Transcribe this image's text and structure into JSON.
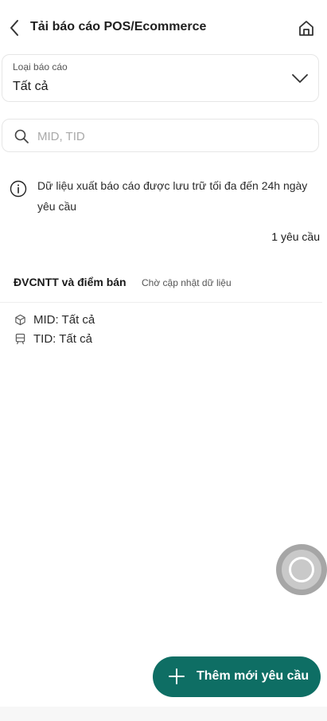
{
  "header": {
    "title": "Tải báo cáo POS/Ecommerce",
    "back_icon": "chevron-left-icon",
    "home_icon": "home-icon"
  },
  "report_type": {
    "label": "Loại báo cáo",
    "value": "Tất cả",
    "icon": "chevron-down-icon"
  },
  "search": {
    "placeholder": "MID, TID",
    "value": "",
    "icon": "search-icon"
  },
  "info": {
    "icon": "info-icon",
    "text": "Dữ liệu xuất báo cáo được lưu trữ tối đa đến 24h ngày yêu cầu"
  },
  "requests": {
    "count_text": "1 yêu cầu",
    "items": [
      {
        "title": "ĐVCNTT và điểm bán",
        "status": "Chờ cập nhật dữ liệu",
        "mid": "MID: Tất cả",
        "tid": "TID: Tất cả"
      }
    ]
  },
  "add_button": {
    "label": "Thêm mới yêu cầu",
    "icon": "plus-icon"
  },
  "colors": {
    "primary": "#0e6e64",
    "border": "#e6e6e6",
    "placeholder": "#a9a9a9"
  }
}
